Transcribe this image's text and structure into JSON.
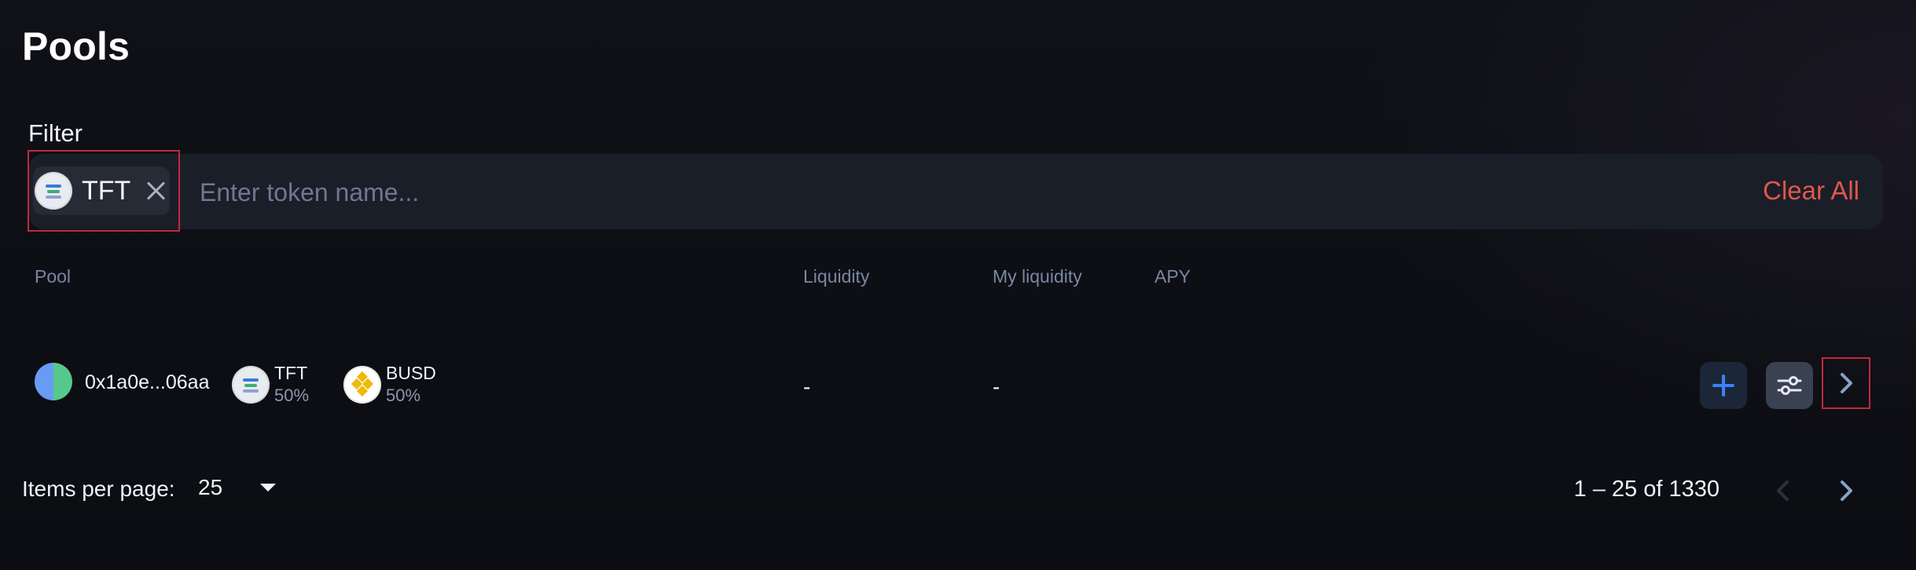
{
  "page": {
    "title": "Pools"
  },
  "filter": {
    "label": "Filter",
    "chip": {
      "token": "TFT"
    },
    "search_placeholder": "Enter token name...",
    "clear_all": "Clear All"
  },
  "table": {
    "headers": {
      "pool": "Pool",
      "liquidity": "Liquidity",
      "my_liquidity": "My liquidity",
      "apy": "APY"
    },
    "rows": [
      {
        "address": "0x1a0e...06aa",
        "tokens": [
          {
            "symbol": "TFT",
            "weight": "50%"
          },
          {
            "symbol": "BUSD",
            "weight": "50%"
          }
        ],
        "liquidity": "-",
        "my_liquidity": "-",
        "apy": ""
      }
    ]
  },
  "pagination": {
    "items_per_page_label": "Items per page:",
    "items_per_page_value": "25",
    "range_label": "1 – 25 of 1330"
  },
  "colors": {
    "accent_red": "#e0584a",
    "accent_blue": "#3b82f6",
    "header_text": "#7b86a3"
  },
  "icons": {
    "chip_close": "close-icon",
    "add": "plus-icon",
    "settings": "sliders-icon",
    "row_next": "chevron-right-icon",
    "page_prev": "chevron-left-icon",
    "page_next": "chevron-right-icon",
    "per_page_dropdown": "caret-down-icon"
  }
}
